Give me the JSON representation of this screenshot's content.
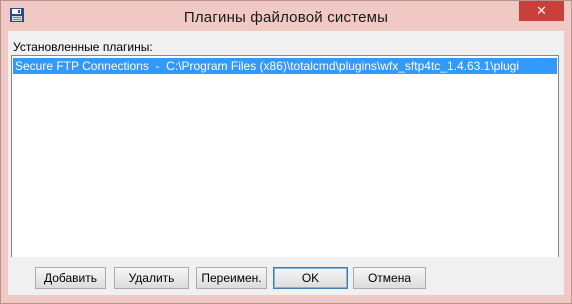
{
  "window": {
    "title": "Плагины файловой системы",
    "close_glyph": "✕"
  },
  "plugins": {
    "label": "Установленные плагины:",
    "items": [
      "Secure FTP Connections  -  C:\\Program Files (x86)\\totalcmd\\plugins\\wfx_sftp4tc_1.4.63.1\\plugi"
    ]
  },
  "buttons": {
    "add": "Добавить",
    "remove": "Удалить",
    "rename": "Переимен.",
    "ok": "OK",
    "cancel": "Отмена"
  },
  "colors": {
    "titlebar": "#f0c8c4",
    "close": "#c7403a",
    "selection": "#3399ff"
  },
  "icons": {
    "app": "floppy-disk-icon"
  }
}
